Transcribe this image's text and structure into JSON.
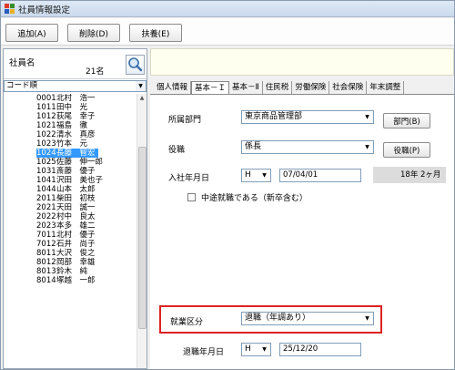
{
  "window": {
    "title": "社員情報設定",
    "icon_colors": [
      "#e03a2a",
      "#3a8a2a",
      "#2a5ac0",
      "#e8b020"
    ]
  },
  "toolbar": {
    "add_label": "追加(A)",
    "delete_label": "削除(D)",
    "dependents_label": "扶養(E)"
  },
  "employee_list": {
    "header_label": "社員名",
    "count": "21名",
    "sort_selected": "コード順",
    "rows": [
      {
        "code": "0001",
        "name": "北村　浩一",
        "selected": false
      },
      {
        "code": "1011",
        "name": "田中　光",
        "selected": false
      },
      {
        "code": "1012",
        "name": "荻尾　幸子",
        "selected": false
      },
      {
        "code": "1021",
        "name": "福島　徹",
        "selected": false
      },
      {
        "code": "1022",
        "name": "清水　真彦",
        "selected": false
      },
      {
        "code": "1023",
        "name": "竹本　元",
        "selected": false
      },
      {
        "code": "1024",
        "name": "長藤　智宏",
        "selected": true
      },
      {
        "code": "1025",
        "name": "佐藤　伸一郎",
        "selected": false
      },
      {
        "code": "1031",
        "name": "斎藤　優子",
        "selected": false
      },
      {
        "code": "1041",
        "name": "沢田　美也子",
        "selected": false
      },
      {
        "code": "1044",
        "name": "山本　太郎",
        "selected": false
      },
      {
        "code": "2011",
        "name": "柴田　初枝",
        "selected": false
      },
      {
        "code": "2021",
        "name": "天田　誠一",
        "selected": false
      },
      {
        "code": "2022",
        "name": "村中　良太",
        "selected": false
      },
      {
        "code": "2023",
        "name": "本多　雄二",
        "selected": false
      },
      {
        "code": "7011",
        "name": "北村　優子",
        "selected": false
      },
      {
        "code": "7012",
        "name": "石井　尚子",
        "selected": false
      },
      {
        "code": "8011",
        "name": "大沢　俊之",
        "selected": false
      },
      {
        "code": "8012",
        "name": "岡部　幸雄",
        "selected": false
      },
      {
        "code": "8013",
        "name": "鈴木　純",
        "selected": false
      },
      {
        "code": "8014",
        "name": "塚越　一郎",
        "selected": false
      }
    ],
    "selected_color": "#3399ff"
  },
  "tabs": [
    {
      "label": "個人情報",
      "active": false
    },
    {
      "label": "基本－Ｉ",
      "active": true
    },
    {
      "label": "基本－Ⅱ",
      "active": false
    },
    {
      "label": "住民税",
      "active": false
    },
    {
      "label": "労働保険",
      "active": false
    },
    {
      "label": "社会保険",
      "active": false
    },
    {
      "label": "年末調整",
      "active": false
    }
  ],
  "form": {
    "department_label": "所属部門",
    "department_value": "東京商品管理部",
    "department_button": "部門(B)",
    "position_label": "役職",
    "position_value": "係長",
    "position_button": "役職(P)",
    "hire_date_label": "入社年月日",
    "hire_era": "H",
    "hire_date": "07/04/01",
    "tenure": "18年 2ヶ月",
    "midcareer_label": "中途就職である（新卒含む）",
    "midcareer_checked": false,
    "employment_label": "就業区分",
    "employment_value": "退職（年調あり）",
    "retire_date_label": "退職年月日",
    "retire_era": "H",
    "retire_date": "25/12/20",
    "highlight_color": "#dd2222"
  }
}
